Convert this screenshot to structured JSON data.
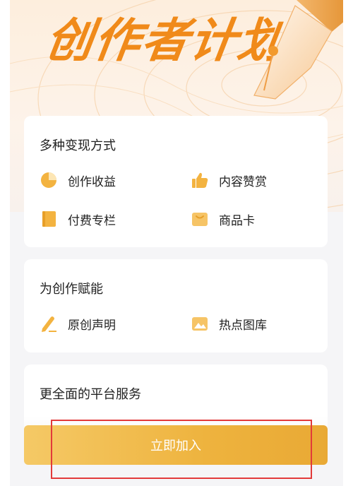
{
  "hero": {
    "title": "创作者计划"
  },
  "cards": [
    {
      "title": "多种变现方式",
      "features": [
        {
          "label": "创作收益",
          "icon": "pie-chart-icon"
        },
        {
          "label": "内容赞赏",
          "icon": "thumbs-up-icon"
        },
        {
          "label": "付费专栏",
          "icon": "book-icon"
        },
        {
          "label": "商品卡",
          "icon": "product-card-icon"
        }
      ]
    },
    {
      "title": "为创作赋能",
      "features": [
        {
          "label": "原创声明",
          "icon": "pencil-icon"
        },
        {
          "label": "热点图库",
          "icon": "image-gallery-icon"
        }
      ]
    },
    {
      "title": "更全面的平台服务",
      "features": []
    }
  ],
  "cta": {
    "label": "立即加入"
  },
  "colors": {
    "accent": "#f0a52a",
    "button_start": "#f5c966",
    "button_end": "#e9a935",
    "highlight_border": "#e23a3a"
  }
}
